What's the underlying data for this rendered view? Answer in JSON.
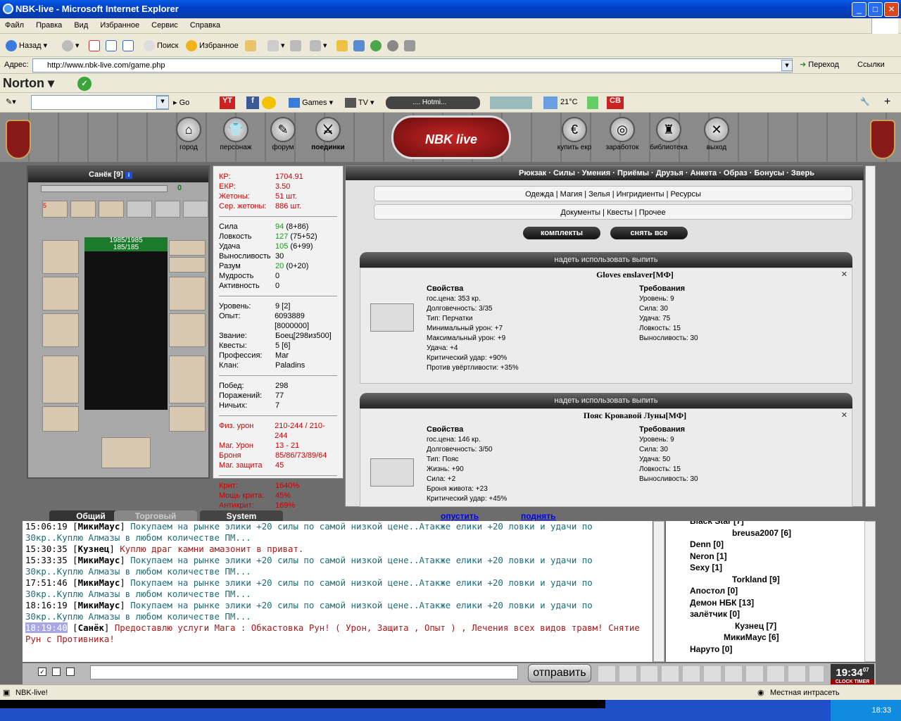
{
  "window": {
    "title": "NBK-live - Microsoft Internet Explorer",
    "min": "_",
    "max": "□",
    "close": "✕"
  },
  "menu": [
    "Файл",
    "Правка",
    "Вид",
    "Избранное",
    "Сервис",
    "Справка"
  ],
  "toolbar": {
    "back": "Назад",
    "search": "Поиск",
    "favorites": "Избранное"
  },
  "address": {
    "label": "Адрес:",
    "url": "http://www.nbk-live.com/game.php",
    "go": "Переход",
    "links": "Ссылки"
  },
  "norton": {
    "label": "Norton"
  },
  "searchbar": {
    "go": "Go",
    "games": "Games",
    "tv": "TV",
    "hotmail": ".... Hotmi...",
    "weather": "21°C",
    "cb": "CB"
  },
  "game": {
    "nav_left": [
      "город",
      "персонаж",
      "форум",
      "поединки"
    ],
    "nav_right": [
      "купить екр",
      "заработок",
      "библиотека",
      "выход"
    ],
    "logo": "NBK live",
    "char": {
      "name": "Санёк [9]",
      "hp": "1985/1985",
      "mp": "185/185",
      "exp_bar": "0",
      "badge": "5",
      "badge2": "900"
    },
    "money": [
      {
        "k": "КР:",
        "v": "1704.91"
      },
      {
        "k": "ЕКР:",
        "v": "3.50"
      },
      {
        "k": "Жетоны:",
        "v": "51 шт."
      },
      {
        "k": "Сер. жетоны:",
        "v": "886 шт."
      }
    ],
    "attrs": [
      {
        "k": "Сила",
        "v": "94",
        "extra": "(8+86)"
      },
      {
        "k": "Ловкость",
        "v": "127",
        "extra": "(75+52)"
      },
      {
        "k": "Удача",
        "v": "105",
        "extra": "(6+99)"
      },
      {
        "k": "Выносливость",
        "v": "30",
        "extra": ""
      },
      {
        "k": "Разум",
        "v": "20",
        "extra": "(0+20)"
      },
      {
        "k": "Мудрость",
        "v": "0",
        "extra": ""
      },
      {
        "k": "Активность",
        "v": "0",
        "extra": ""
      }
    ],
    "info": [
      {
        "k": "Уровень:",
        "v": "9 [2]"
      },
      {
        "k": "Опыт:",
        "v": "6093889 [8000000]"
      },
      {
        "k": "Звание:",
        "v": "Боец[298из500]"
      },
      {
        "k": "Квесты:",
        "v": "5 [6]"
      },
      {
        "k": "Профессия:",
        "v": "Маг"
      },
      {
        "k": "Клан:",
        "v": "Paladins"
      }
    ],
    "record": [
      {
        "k": "Побед:",
        "v": "298"
      },
      {
        "k": "Поражений:",
        "v": "77"
      },
      {
        "k": "Ничьих:",
        "v": "7"
      }
    ],
    "combat": [
      {
        "k": "Физ. урон",
        "v": "210-244 / 210-244"
      },
      {
        "k": "Маг. Урон",
        "v": "13 - 21"
      },
      {
        "k": "Броня",
        "v": "85/86/73/89/64"
      },
      {
        "k": "Маг. защита",
        "v": "45"
      }
    ],
    "crit": [
      {
        "k": "Крит:",
        "v": "1640%"
      },
      {
        "k": "Мощь крита:",
        "v": "45%"
      },
      {
        "k": "Антикрит:",
        "v": "169%"
      }
    ],
    "inv_tabs": "Рюкзак · Силы · Умения · Приёмы · Друзья · Анкета · Образ · Бонусы · Зверь",
    "inv_sub1": "Одежда | Магия | Зелья | Ингридиенты | Ресурсы",
    "inv_sub2": "Документы | Квесты | Прочее",
    "btn_sets": "комплекты",
    "btn_remove": "снять все",
    "actions": "надеть   использовать   выпить",
    "items": [
      {
        "name": "Gloves enslaver[МФ]",
        "props_title": "Свойства",
        "props": [
          "гос.цена: 353 кр.",
          "Долговечность: 3/35",
          "Тип: Перчатки",
          "Минимальный урон: +7",
          "Максимальный урон: +9",
          "Удача: +4",
          "Критический удар: +90%",
          "Против увёртливости: +35%"
        ],
        "req_title": "Требования",
        "reqs": [
          "Уровень: 9",
          "Сила: 30",
          "Удача: 75",
          "Ловкость: 15",
          "Выносливость: 30"
        ]
      },
      {
        "name": "Пояс Кровавой Луны[МФ]",
        "props_title": "Свойства",
        "props": [
          "гос.цена: 146 кр.",
          "Долговечность: 3/50",
          "Тип: Пояс",
          "Жизнь: +90",
          "Сила: +2",
          "Броня живота: +23",
          "Критический удар: +45%"
        ],
        "req_title": "Требования",
        "reqs": [
          "Уровень: 9",
          "Сила: 30",
          "Удача: 50",
          "Ловкость: 15",
          "Выносливость: 30"
        ]
      }
    ],
    "drop_btn": "опустить",
    "lift_btn": "поднять"
  },
  "chat": {
    "tabs": [
      "Общий",
      "Торговый",
      "System"
    ],
    "lines": [
      {
        "t": "15:06:19",
        "n": "МикиМаус",
        "m": "Покупаем на рынке элики +20 силы по самой низкой цене..Атакже елики +20 ловки и удачи по 30кр..Куплю Алмазы в любом количестве ПМ..."
      },
      {
        "t": "15:30:35",
        "n": "Кузнец",
        "m": "Куплю драг камни амазонит в приват."
      },
      {
        "t": "15:33:35",
        "n": "МикиМаус",
        "m": "Покупаем на рынке элики +20 силы по самой низкой цене..Атакже елики +20 ловки и удачи по 30кр..Куплю Алмазы в любом количестве ПМ..."
      },
      {
        "t": "17:51:46",
        "n": "МикиМаус",
        "m": "Покупаем на рынке элики +20 силы по самой низкой цене..Атакже елики +20 ловки и удачи по 30кр..Куплю Алмазы в любом количестве ПМ..."
      },
      {
        "t": "18:16:19",
        "n": "МикиМаус",
        "m": "Покупаем на рынке элики +20 силы по самой низкой цене..Атакже елики +20 ловки и удачи по 30кр..Куплю Алмазы в любом количестве ПМ..."
      },
      {
        "t": "18:19:40",
        "n": "Санёк",
        "m": "Предоставлю услуги Мага : Обкастовка Рун! ( Урон, Защита , Опыт ) , Лечения всех видов травм! Снятие Рун с Противника!"
      }
    ],
    "users": [
      "Black Star [7]",
      "breusa2007 [6]",
      "Denn [0]",
      "Neron [1]",
      "Sexy [1]",
      "Torkland [9]",
      "Апостол [0]",
      "Демон НБК [13]",
      "залётчик [0]",
      "Кузнец [7]",
      "МикиМаус [6]",
      "Наруто [0]"
    ],
    "send": "отправить",
    "clock": "19:34",
    "clock_sub": "07",
    "clock_label": "CLOCK TIMER"
  },
  "status": {
    "left": "NBK-live!",
    "zone": "Местная интрасеть",
    "time": "18:33"
  }
}
